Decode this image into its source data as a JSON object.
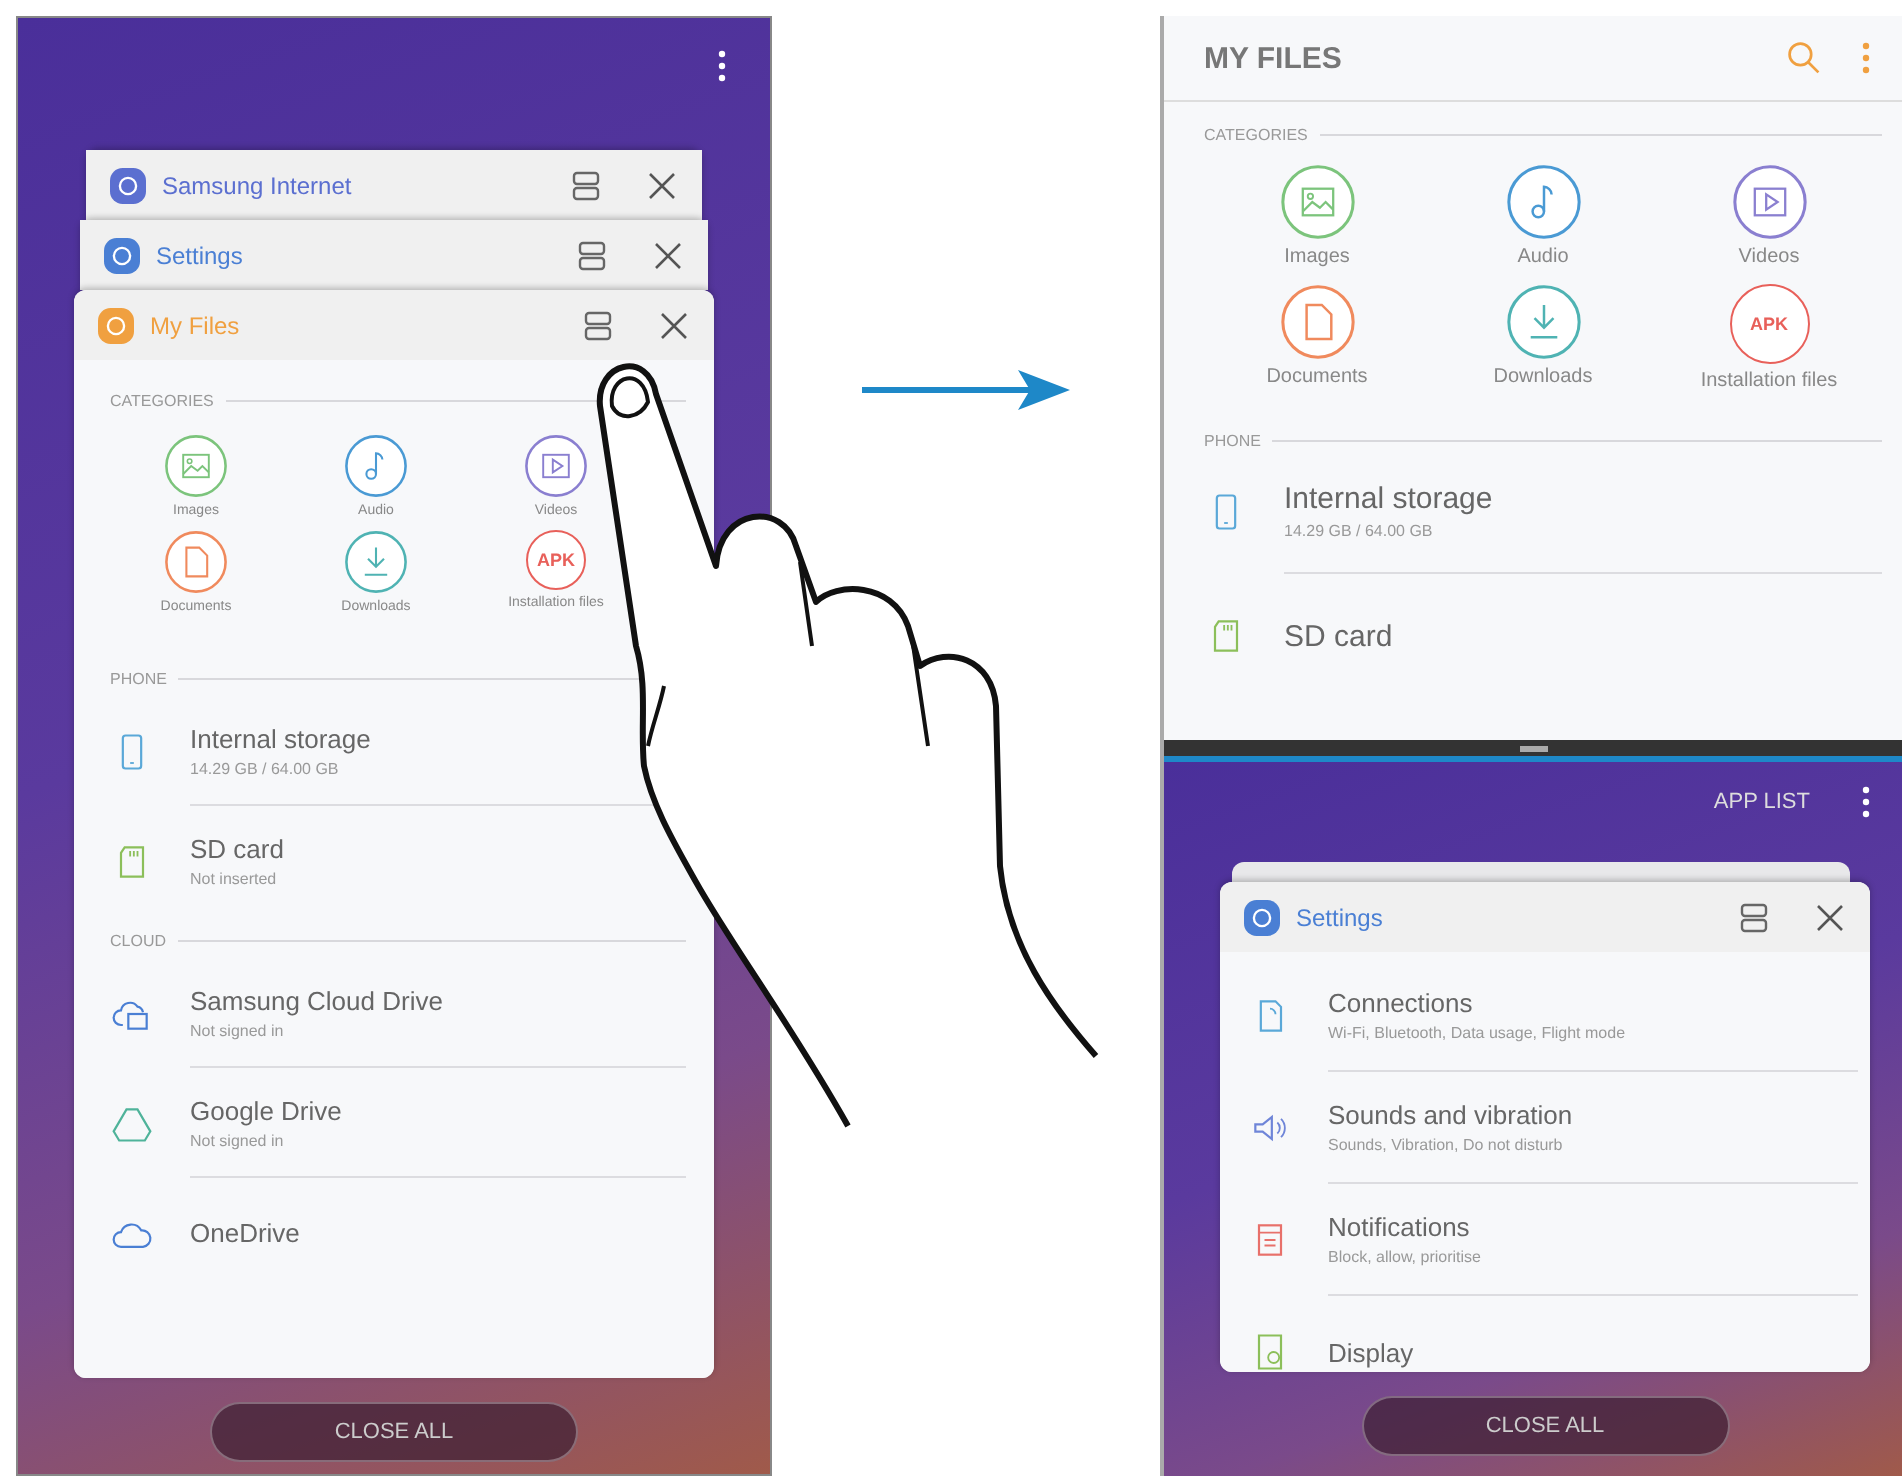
{
  "left_screen": {
    "recent_apps": [
      {
        "title": "Samsung Internet",
        "color": "#5b6fd0"
      },
      {
        "title": "Settings",
        "color": "#4a7fd4"
      },
      {
        "title": "My Files",
        "color": "#f0a040"
      }
    ],
    "my_files": {
      "sections": [
        {
          "header": "CATEGORIES",
          "kind": "grid",
          "items": [
            {
              "label": "Images",
              "kind": "images",
              "color": "#7cc47c"
            },
            {
              "label": "Audio",
              "kind": "audio",
              "color": "#4a9ad4"
            },
            {
              "label": "Videos",
              "kind": "videos",
              "color": "#8a7fd0"
            },
            {
              "label": "Documents",
              "kind": "documents",
              "color": "#f08a5d"
            },
            {
              "label": "Downloads",
              "kind": "downloads",
              "color": "#4fb3b3"
            },
            {
              "label": "Installation files",
              "kind": "apk",
              "glyph": "APK",
              "color": "#e8605a"
            }
          ]
        },
        {
          "header": "PHONE",
          "kind": "list",
          "items": [
            {
              "title": "Internal storage",
              "subtitle": "14.29 GB / 64.00 GB",
              "kind": "phone"
            },
            {
              "title": "SD card",
              "subtitle": "Not inserted",
              "kind": "sdcard"
            }
          ]
        },
        {
          "header": "CLOUD",
          "kind": "list",
          "items": [
            {
              "title": "Samsung Cloud Drive",
              "subtitle": "Not signed in",
              "kind": "cloudfolder"
            },
            {
              "title": "Google Drive",
              "subtitle": "Not signed in",
              "kind": "drive"
            },
            {
              "title": "OneDrive",
              "kind": "cloud"
            }
          ]
        }
      ]
    },
    "close_all": "CLOSE ALL"
  },
  "right_screen": {
    "top": {
      "title": "MY FILES",
      "sections": [
        {
          "header": "CATEGORIES",
          "kind": "grid",
          "items": [
            {
              "label": "Images",
              "kind": "images",
              "color": "#7cc47c"
            },
            {
              "label": "Audio",
              "kind": "audio",
              "color": "#4a9ad4"
            },
            {
              "label": "Videos",
              "kind": "videos",
              "color": "#8a7fd0"
            },
            {
              "label": "Documents",
              "kind": "documents",
              "color": "#f08a5d"
            },
            {
              "label": "Downloads",
              "kind": "downloads",
              "color": "#4fb3b3"
            },
            {
              "label": "Installation files",
              "kind": "apk",
              "glyph": "APK",
              "color": "#e8605a"
            }
          ]
        },
        {
          "header": "PHONE",
          "kind": "list",
          "items": [
            {
              "title": "Internal storage",
              "subtitle": "14.29 GB / 64.00 GB",
              "kind": "phone"
            },
            {
              "title": "SD card",
              "kind": "sdcard"
            }
          ]
        }
      ]
    },
    "bottom": {
      "app_list": "APP LIST",
      "card": {
        "title": "Settings",
        "color": "#4a7fd4",
        "items": [
          {
            "title": "Connections",
            "subtitle": "Wi-Fi, Bluetooth, Data usage, Flight mode",
            "kind": "connections"
          },
          {
            "title": "Sounds and vibration",
            "subtitle": "Sounds, Vibration, Do not disturb",
            "kind": "sound"
          },
          {
            "title": "Notifications",
            "subtitle": "Block, allow, prioritise",
            "kind": "notifications"
          },
          {
            "title": "Display",
            "kind": "display"
          }
        ]
      },
      "close_all": "CLOSE ALL"
    }
  }
}
